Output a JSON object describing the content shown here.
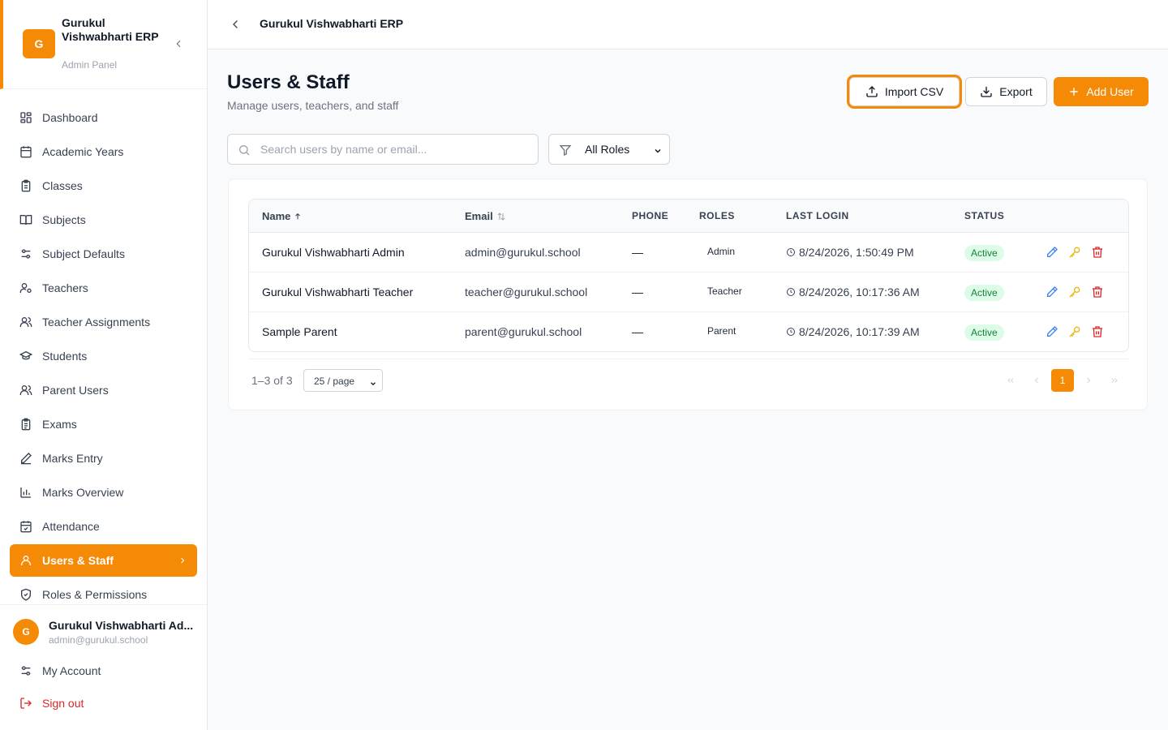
{
  "app": {
    "logo_letter": "G",
    "name": "Gurukul Vishwabharti ERP",
    "subtitle": "Admin Panel"
  },
  "sidebar": {
    "items": [
      {
        "label": "Dashboard",
        "icon": "dashboard-icon"
      },
      {
        "label": "Academic Years",
        "icon": "calendar-icon"
      },
      {
        "label": "Classes",
        "icon": "clipboard-icon"
      },
      {
        "label": "Subjects",
        "icon": "book-icon"
      },
      {
        "label": "Subject Defaults",
        "icon": "sliders-icon"
      },
      {
        "label": "Teachers",
        "icon": "user-settings-icon"
      },
      {
        "label": "Teacher Assignments",
        "icon": "users-icon"
      },
      {
        "label": "Students",
        "icon": "graduation-cap-icon"
      },
      {
        "label": "Parent Users",
        "icon": "users-icon"
      },
      {
        "label": "Exams",
        "icon": "clipboard-list-icon"
      },
      {
        "label": "Marks Entry",
        "icon": "pencil-icon"
      },
      {
        "label": "Marks Overview",
        "icon": "bar-chart-icon"
      },
      {
        "label": "Attendance",
        "icon": "calendar-check-icon"
      },
      {
        "label": "Users & Staff",
        "icon": "user-icon",
        "active": true
      },
      {
        "label": "Roles & Permissions",
        "icon": "shield-icon"
      }
    ]
  },
  "current_user": {
    "avatar_letter": "G",
    "name": "Gurukul Vishwabharti Ad...",
    "email": "admin@gurukul.school"
  },
  "footer_links": {
    "account": "My Account",
    "signout": "Sign out"
  },
  "topbar": {
    "title": "Gurukul Vishwabharti ERP"
  },
  "page": {
    "title": "Users & Staff",
    "subtitle": "Manage users, teachers, and staff"
  },
  "actions": {
    "import": "Import CSV",
    "export": "Export",
    "add": "Add User"
  },
  "filters": {
    "search_placeholder": "Search users by name or email...",
    "search_value": "",
    "role_selected": "All Roles"
  },
  "table": {
    "columns": {
      "name": "Name",
      "email": "Email",
      "phone": "PHONE",
      "roles": "ROLES",
      "last_login": "LAST LOGIN",
      "status": "STATUS"
    },
    "rows": [
      {
        "name": "Gurukul Vishwabharti Admin",
        "email": "admin@gurukul.school",
        "phone": "—",
        "role": "Admin",
        "last_login": "8/24/2026, 1:50:49 PM",
        "status": "Active"
      },
      {
        "name": "Gurukul Vishwabharti Teacher",
        "email": "teacher@gurukul.school",
        "phone": "—",
        "role": "Teacher",
        "last_login": "8/24/2026, 10:17:36 AM",
        "status": "Active"
      },
      {
        "name": "Sample Parent",
        "email": "parent@gurukul.school",
        "phone": "—",
        "role": "Parent",
        "last_login": "8/24/2026, 10:17:39 AM",
        "status": "Active"
      }
    ]
  },
  "pagination": {
    "summary": "1–3 of 3",
    "page_size": "25 / page",
    "current_page": "1"
  },
  "colors": {
    "accent": "#f58a07",
    "status_active_bg": "#dcfce7",
    "status_active_text": "#15803d",
    "edit_icon": "#3b82f6",
    "key_icon": "#eab308",
    "delete_icon": "#dc2626"
  }
}
